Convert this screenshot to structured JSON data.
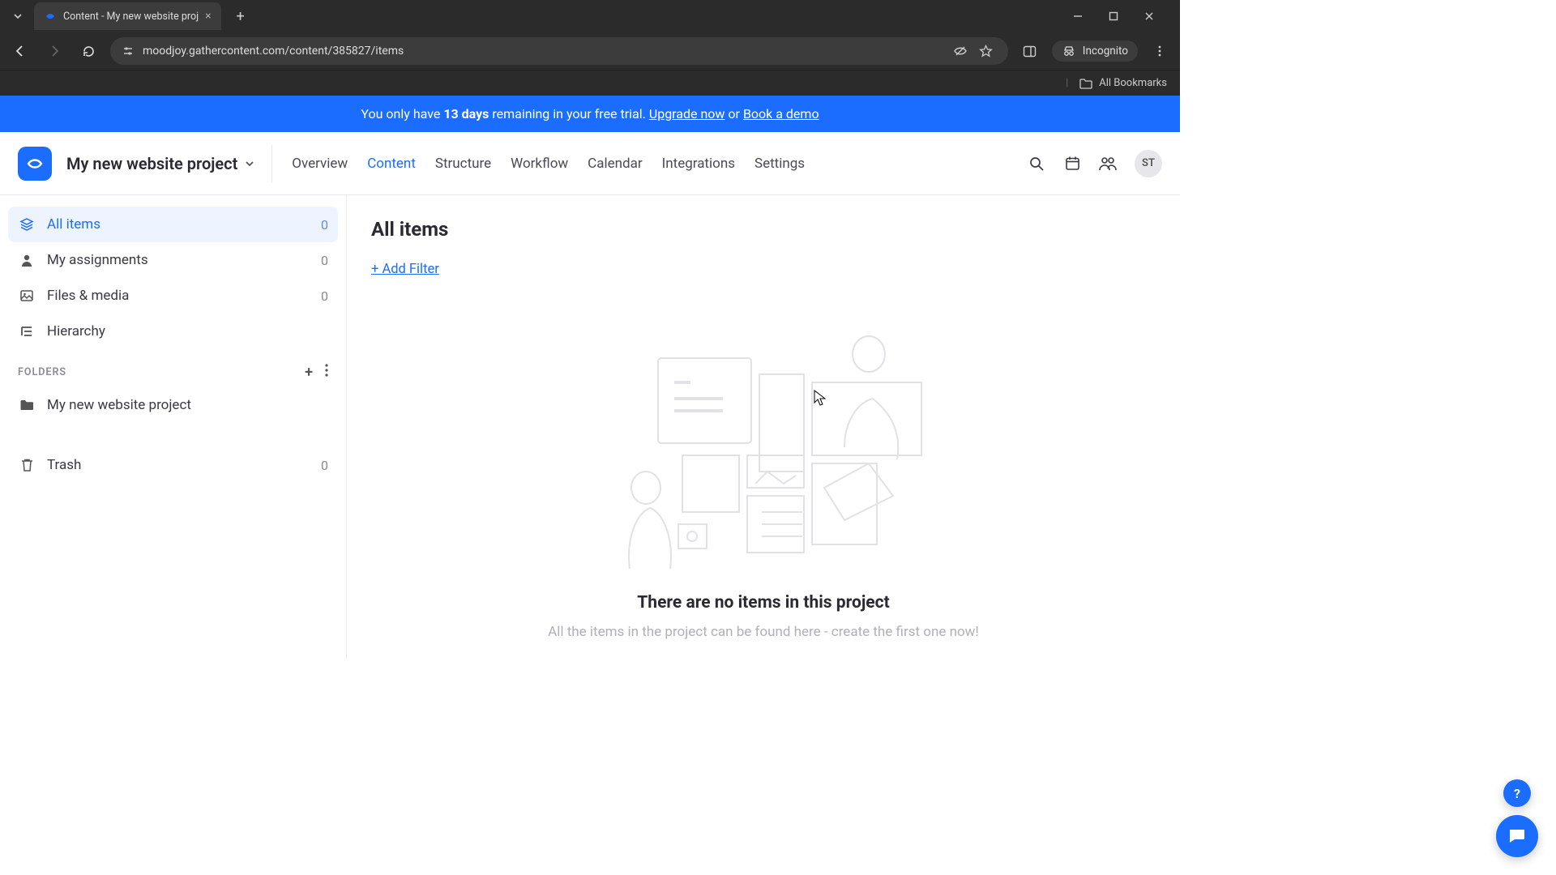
{
  "browser": {
    "tab_title": "Content - My new website proj",
    "url": "moodjoy.gathercontent.com/content/385827/items",
    "incognito_label": "Incognito",
    "all_bookmarks": "All Bookmarks"
  },
  "banner": {
    "prefix": "You only have ",
    "days": "13 days",
    "middle": " remaining in your free trial. ",
    "upgrade": "Upgrade now",
    "or": " or ",
    "demo": "Book a demo"
  },
  "header": {
    "project_name": "My new website project",
    "nav": {
      "overview": "Overview",
      "content": "Content",
      "structure": "Structure",
      "workflow": "Workflow",
      "calendar": "Calendar",
      "integrations": "Integrations",
      "settings": "Settings"
    },
    "avatar": "ST"
  },
  "sidebar": {
    "all_items": {
      "label": "All items",
      "count": "0"
    },
    "assignments": {
      "label": "My assignments",
      "count": "0"
    },
    "files": {
      "label": "Files & media",
      "count": "0"
    },
    "hierarchy": {
      "label": "Hierarchy"
    },
    "folders_header": "FOLDERS",
    "folder1": {
      "label": "My new website project"
    },
    "trash": {
      "label": "Trash",
      "count": "0"
    }
  },
  "main": {
    "title": "All items",
    "add_filter": "+ Add Filter",
    "empty_title": "There are no items in this project",
    "empty_sub": "All the items in the project can be found here - create the first one now!"
  }
}
